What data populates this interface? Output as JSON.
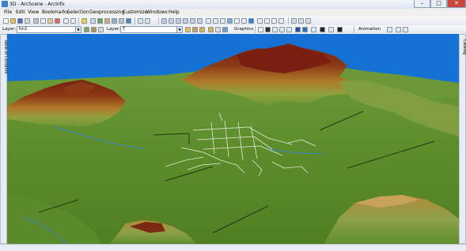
{
  "window": {
    "title": "3D - ArcScene - ArcInfo"
  },
  "menu": [
    "File",
    "Edit",
    "View",
    "Bookmarks",
    "Selection",
    "Geoprocessing",
    "Customize",
    "Windows",
    "Help"
  ],
  "layer_toolbar": {
    "label": "Layer:",
    "value": "tin1"
  },
  "layer_toolbar2": {
    "label": "Layer:",
    "value": "T"
  },
  "graphics": {
    "label": "Graphics"
  },
  "animation": {
    "label": "Animation"
  },
  "sidebar": {
    "left": "Table of Contents",
    "right": "Catalog"
  },
  "colors": {
    "sky": "#1572d4",
    "low_terrain": "#5c8f2b",
    "high_terrain": "#7a2010",
    "roads": "#e8e8d8"
  },
  "icons": [
    "new-icon",
    "open-icon",
    "save-icon",
    "print-icon",
    "cut-icon",
    "copy-icon",
    "paste-icon",
    "delete-icon",
    "undo-icon",
    "redo-icon",
    "add-data-icon",
    "navigate-icon",
    "fly-icon",
    "zoom-in-icon",
    "zoom-out-icon",
    "pan-icon",
    "full-extent-icon",
    "select-icon",
    "identify-icon",
    "measure-icon",
    "help-icon"
  ]
}
